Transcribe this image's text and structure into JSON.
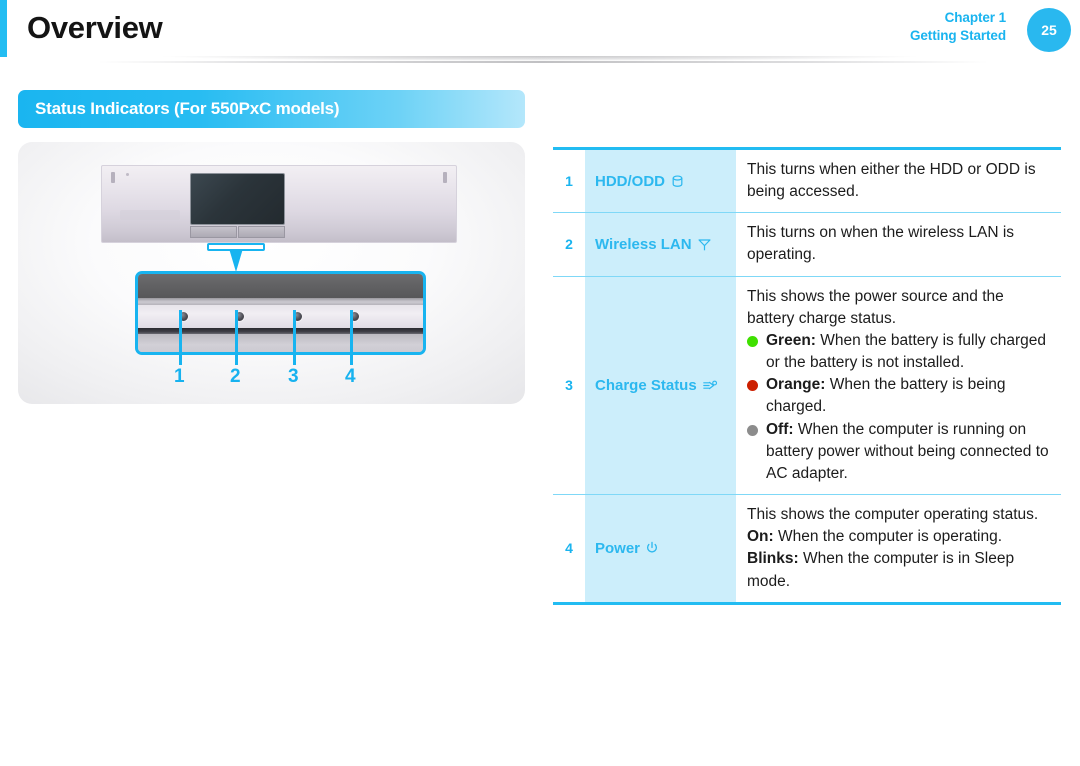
{
  "header": {
    "title": "Overview",
    "chapter_line1": "Chapter 1",
    "chapter_line2": "Getting Started",
    "page_number": "25"
  },
  "section": {
    "heading": "Status Indicators (For 550PxC models)"
  },
  "illustration": {
    "callouts": [
      "1",
      "2",
      "3",
      "4"
    ]
  },
  "table": {
    "rows": [
      {
        "num": "1",
        "label": "HDD/ODD",
        "icon": "hdd-disk-icon",
        "desc": "This turns when either the HDD or ODD is being accessed."
      },
      {
        "num": "2",
        "label": "Wireless LAN",
        "icon": "wireless-antenna-icon",
        "desc": "This turns on when the wireless LAN is operating."
      },
      {
        "num": "3",
        "label": "Charge Status",
        "icon": "power-plug-icon",
        "intro": "This shows the power source and the battery charge status.",
        "bullets": [
          {
            "color": "#3fe000",
            "color_name": "green",
            "term": "Green:",
            "text": " When the battery is fully charged or the battery is not installed."
          },
          {
            "color": "#cc1f00",
            "color_name": "orange",
            "term": "Orange:",
            "text": " When the battery is being charged."
          },
          {
            "color": "#8c8c8c",
            "color_name": "off",
            "term": "Off:",
            "text": " When the computer is running on battery power without being connected to AC adapter."
          }
        ]
      },
      {
        "num": "4",
        "label": "Power",
        "icon": "power-symbol-icon",
        "intro": "This shows the computer operating status.",
        "lines": [
          {
            "term": "On:",
            "text": " When the computer is operating."
          },
          {
            "term": "Blinks:",
            "text": " When the computer is in Sleep mode."
          }
        ]
      }
    ]
  },
  "colors": {
    "accent": "#22bcf2",
    "label_bg": "#cceefb",
    "label_text": "#2cb8ef",
    "divider": "#7fd8f7"
  }
}
